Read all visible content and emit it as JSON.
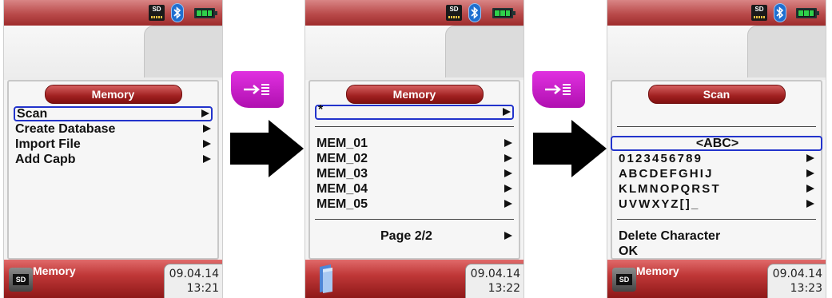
{
  "screens": [
    {
      "title": "Memory",
      "items": [
        "Scan",
        "Create Database",
        "Import File",
        "Add Capb"
      ],
      "bottom": {
        "title": "Memory",
        "date": "09.04.14",
        "time": "13:21"
      }
    },
    {
      "title": "Memory",
      "top_item": "*",
      "items": [
        "MEM_01",
        "MEM_02",
        "MEM_03",
        "MEM_04",
        "MEM_05"
      ],
      "page": "Page 2/2",
      "bottom": {
        "title": "",
        "date": "09.04.14",
        "time": "13:22"
      }
    },
    {
      "title": "Scan",
      "input_field": "<ABC>",
      "char_rows": [
        "0 1 2 3 4 5 6 7 8 9",
        "A B C D E F G H I J",
        "K L M N O P Q R S T",
        "U V W X Y Z [ ] _"
      ],
      "actions": [
        "Delete Character",
        "OK"
      ],
      "bottom": {
        "title": "Memory",
        "date": "09.04.14",
        "time": "13:23"
      }
    }
  ],
  "icons": {
    "status": [
      "sd-card-icon",
      "bluetooth-icon",
      "battery-icon"
    ],
    "key": "enter-key-icon",
    "arrow": "right-arrow-icon",
    "folder": "folder-icon"
  },
  "colors": {
    "header_red": "#b94a4a",
    "selection_blue": "#2233cc",
    "key_magenta": "#d020d0",
    "battery_green": "#2fd04a"
  },
  "sd_label": "SD"
}
